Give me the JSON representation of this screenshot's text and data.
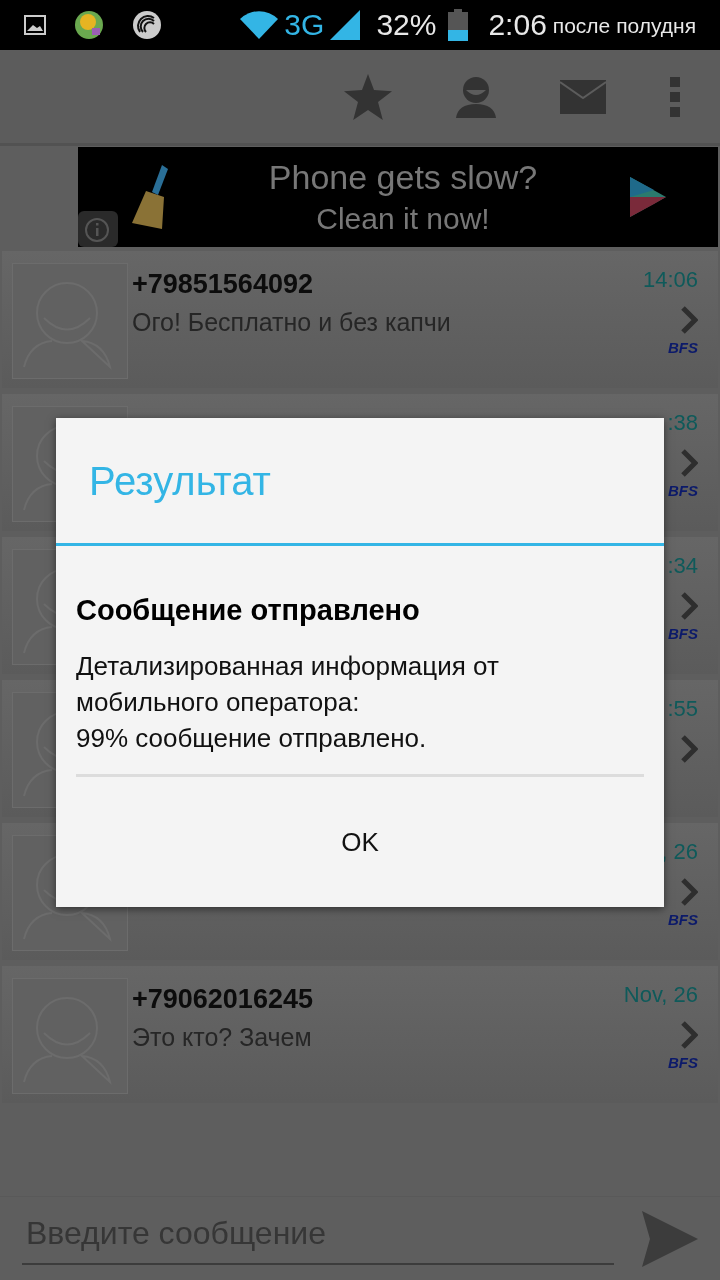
{
  "status_bar": {
    "network": "3G",
    "battery": "32%",
    "time": "2:06",
    "period": "после полудня"
  },
  "ad": {
    "line_1": "Phone gets slow?",
    "line_2": "Clean it now!"
  },
  "conversations": [
    {
      "sender": "+79851564092",
      "preview": "Ого! Бесплатно и без капчи",
      "time": "14:06",
      "badge": "BFS"
    },
    {
      "time": ":38",
      "badge": "BFS"
    },
    {
      "time": ":34",
      "badge": "BFS"
    },
    {
      "time": ":55"
    },
    {
      "time": ", 26",
      "badge": "BFS"
    },
    {
      "sender": "+79062016245",
      "preview": "Это кто? Зачем",
      "time": "Nov, 26",
      "badge": "BFS"
    }
  ],
  "input": {
    "placeholder": "Введите сообщение"
  },
  "dialog": {
    "title": "Результат",
    "heading": "Сообщение отправлено",
    "body": [
      "Детализированная информация от мобильного оператора:",
      "99% сообщение отправлено."
    ],
    "button": "OK"
  }
}
